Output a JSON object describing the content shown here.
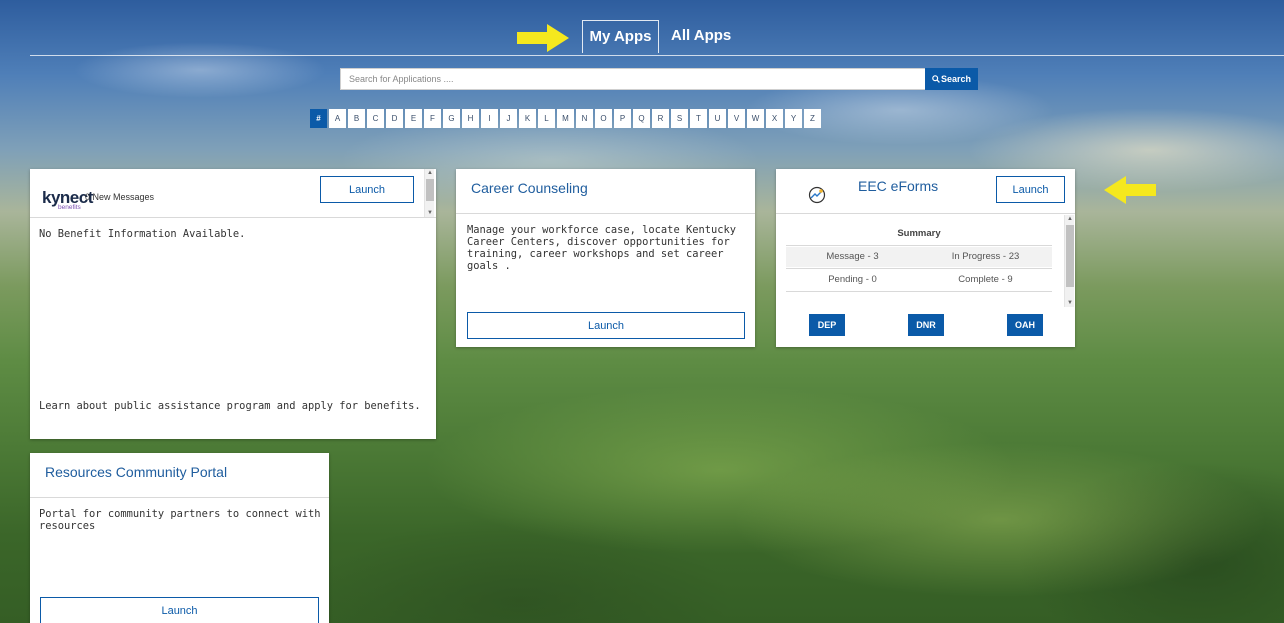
{
  "nav": {
    "my_apps": "My Apps",
    "all_apps": "All Apps"
  },
  "search": {
    "placeholder": "Search for Applications ....",
    "button_label": "Search"
  },
  "alpha": [
    "#",
    "A",
    "B",
    "C",
    "D",
    "E",
    "F",
    "G",
    "H",
    "I",
    "J",
    "K",
    "L",
    "M",
    "N",
    "O",
    "P",
    "Q",
    "R",
    "S",
    "T",
    "U",
    "V",
    "W",
    "X",
    "Y",
    "Z"
  ],
  "kynect": {
    "logo_text": "kynect",
    "logo_sub": "benefits",
    "messages": "0 New Messages",
    "launch": "Launch",
    "no_info": "No Benefit Information Available.",
    "description": "Learn about public assistance program and apply for benefits."
  },
  "career": {
    "title": "Career Counseling",
    "description": "Manage your workforce case, locate Kentucky Career Centers, discover opportunities for training, career workshops and set career goals .",
    "launch": "Launch"
  },
  "eec": {
    "title": "EEC eForms",
    "launch": "Launch",
    "summary_title": "Summary",
    "message": "Message - 3",
    "in_progress": "In Progress - 23",
    "pending": "Pending - 0",
    "complete": "Complete - 9",
    "buttons": [
      "DEP",
      "DNR",
      "OAH"
    ]
  },
  "resources": {
    "title": "Resources Community Portal",
    "description": "Portal for community partners to connect with resources",
    "launch": "Launch"
  },
  "colors": {
    "brand_blue": "#0b5aa8",
    "title_blue": "#1f5d9e",
    "arrow_yellow": "#f5e81e"
  }
}
